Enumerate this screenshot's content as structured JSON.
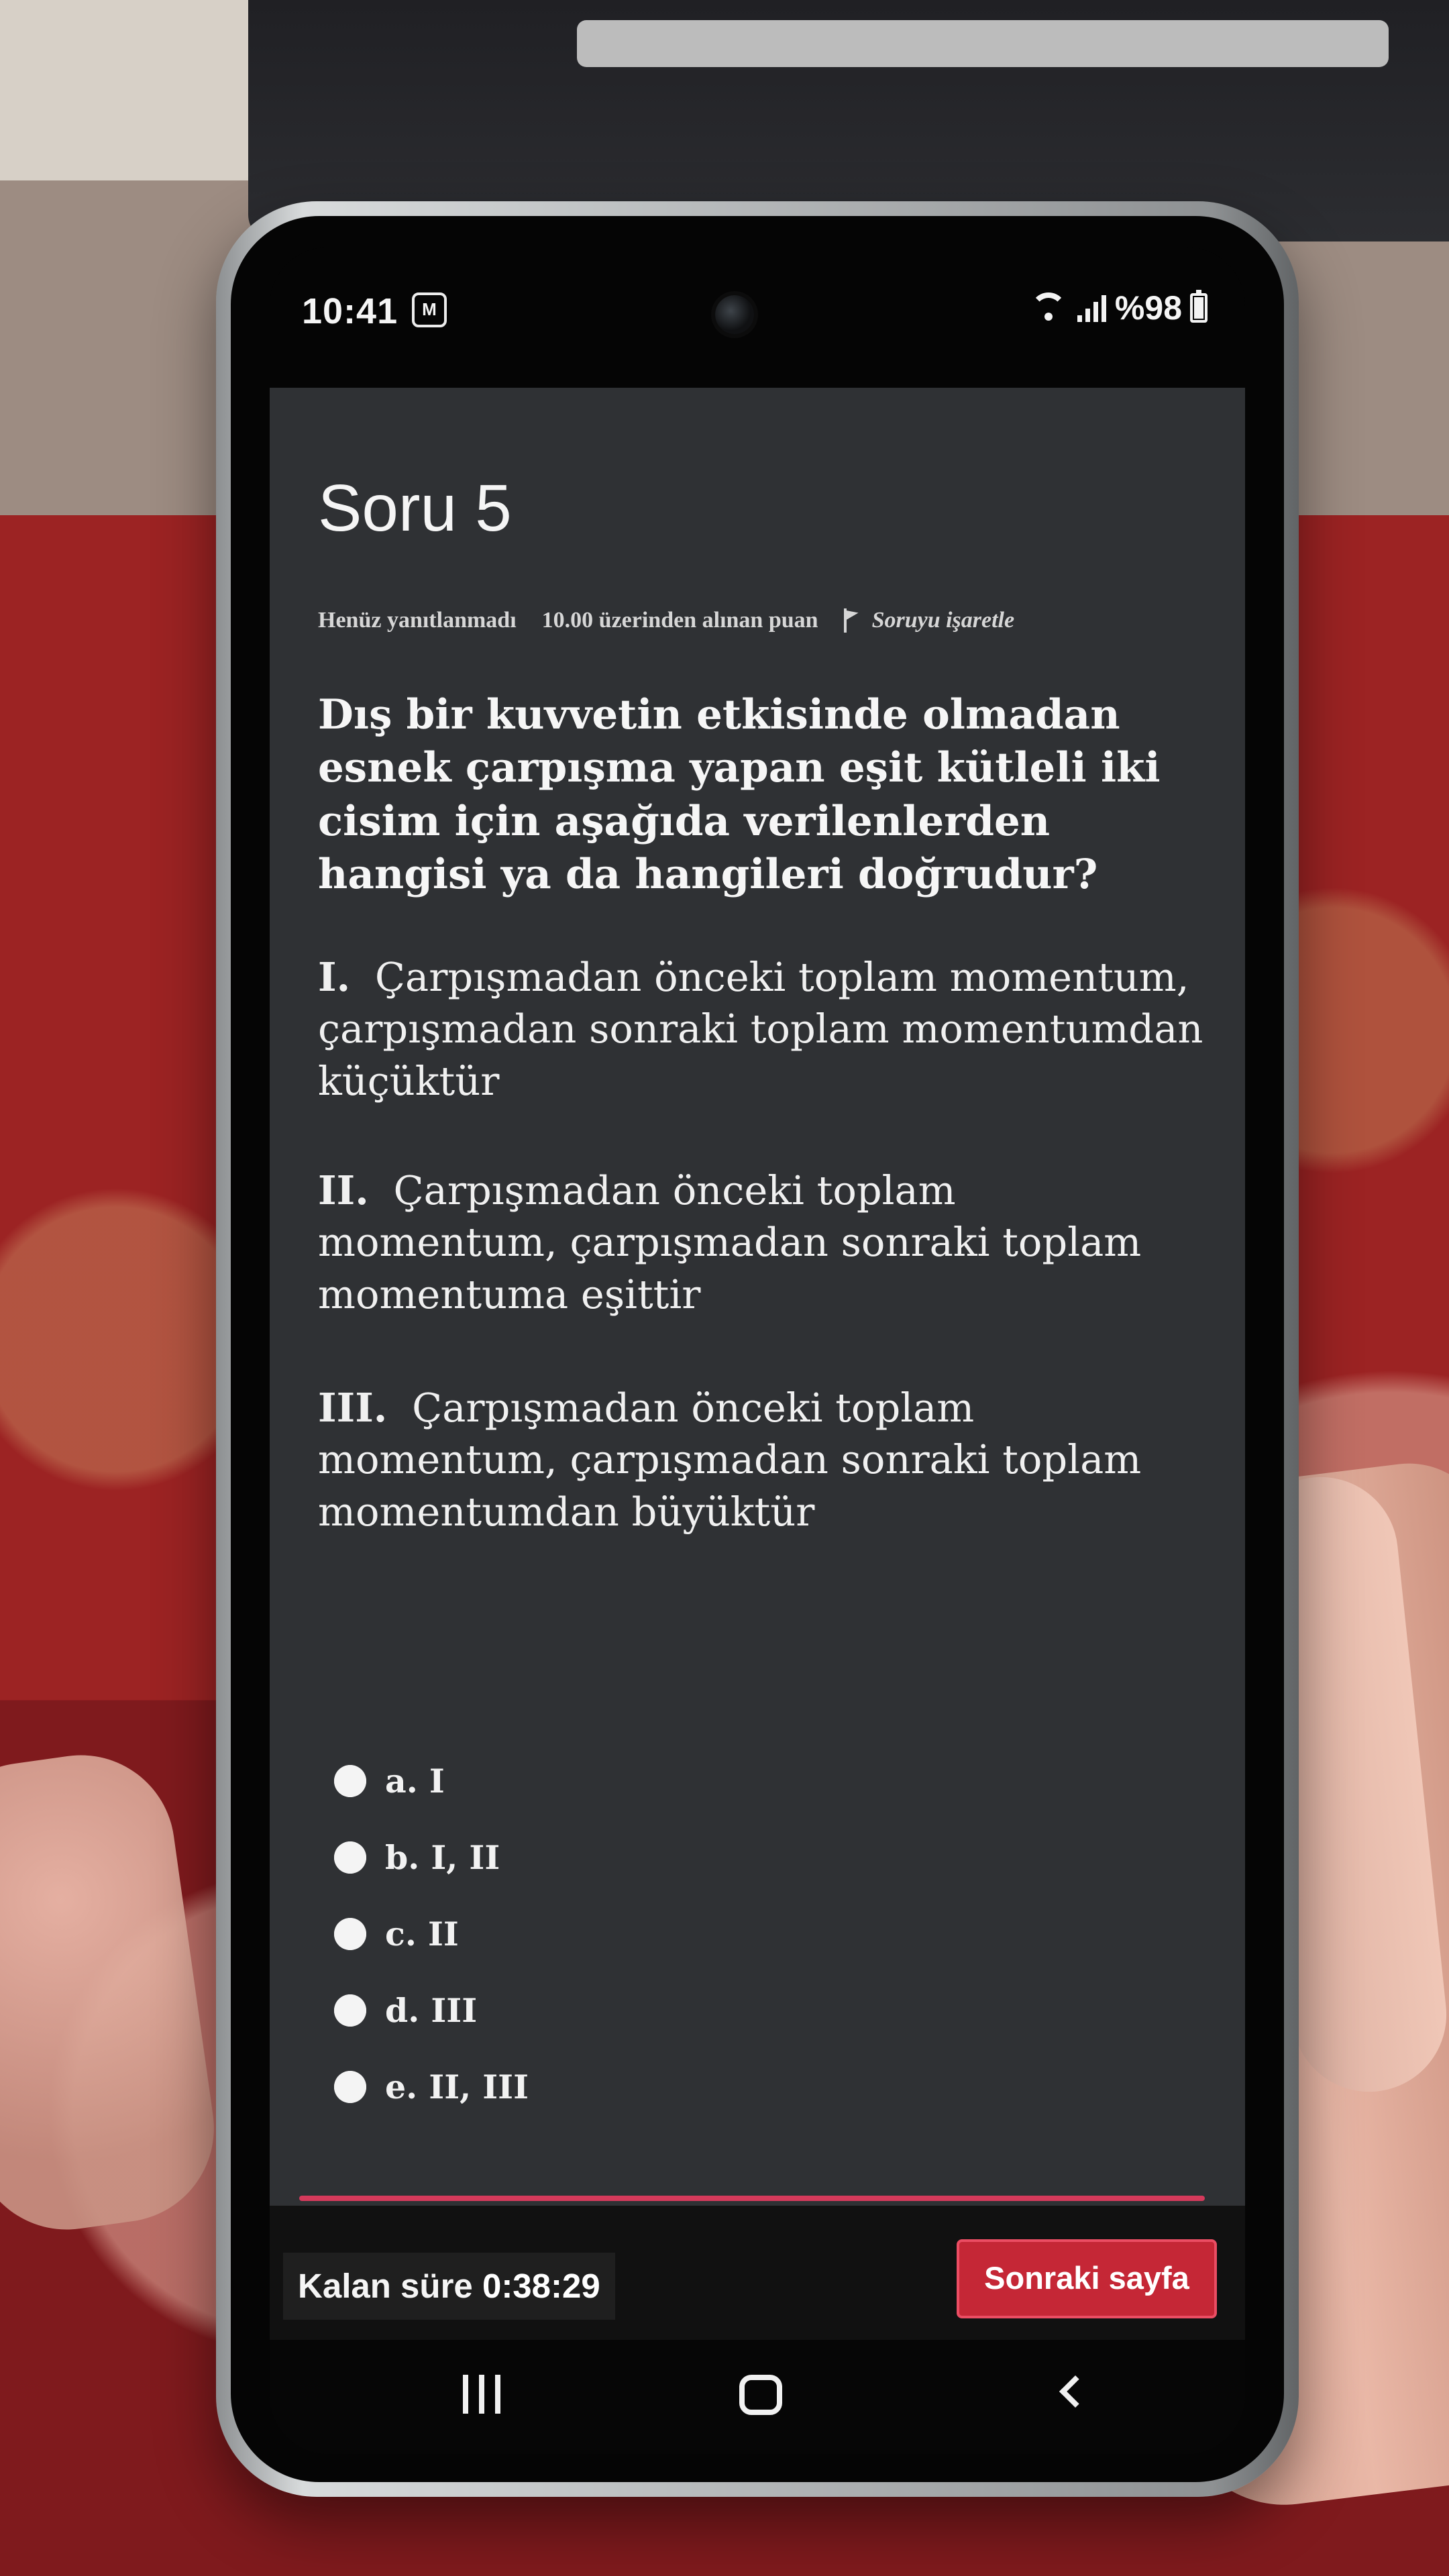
{
  "status_bar": {
    "time": "10:41",
    "badge": "M",
    "battery": "%98"
  },
  "question": {
    "title": "Soru 5",
    "status": "Henüz yanıtlanmadı",
    "points": "10.00 üzerinden alınan puan",
    "flag_label": "Soruyu işaretle",
    "prompt_part1": "Dış bir kuvvetin etkisinde olmadan ",
    "prompt_emph": "esnek çarpışma",
    "prompt_part2": " yapan eşit kütleli iki cisim için aşağıda verilenlerden hangisi ya da hangileri doğrudur?"
  },
  "statements": [
    {
      "roman": "I.",
      "text": "Çarpışmadan önceki toplam momentum, çarpışmadan sonraki toplam momentumdan küçüktür"
    },
    {
      "roman": "II.",
      "text": "Çarpışmadan önceki toplam momentum, çarpışmadan sonraki toplam momentuma eşittir"
    },
    {
      "roman": "III.",
      "text": "Çarpışmadan önceki toplam momentum, çarpışmadan sonraki toplam momentumdan büyüktür"
    }
  ],
  "answers": [
    {
      "label": "a. I"
    },
    {
      "label": "b. I, II"
    },
    {
      "label": "c. II"
    },
    {
      "label": "d. III"
    },
    {
      "label": "e. II, III"
    }
  ],
  "footer": {
    "timer_label": "Kalan süre",
    "timer_value": "0:38:29",
    "next_button": "Sonraki sayfa"
  }
}
